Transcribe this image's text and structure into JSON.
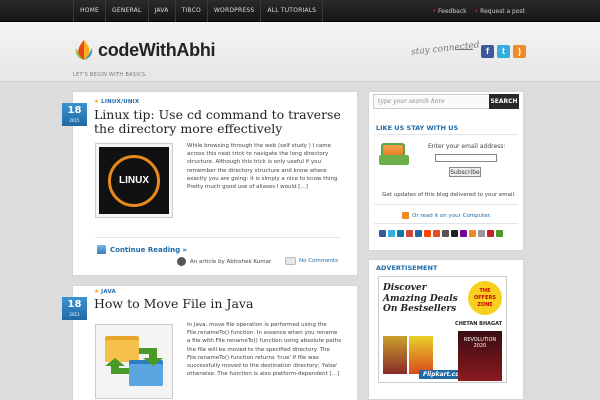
{
  "nav": {
    "items": [
      "HOME",
      "GENERAL",
      "JAVA",
      "TIBCO",
      "WORDPRESS",
      "ALL TUTORIALS"
    ],
    "feedback": "Feedback",
    "request": "Request a post"
  },
  "header": {
    "logo_text": "codeWithAbhi",
    "tagline": "LET'S BEGIN WITH BASICS.",
    "stay_connected": "stay connected"
  },
  "posts": [
    {
      "day": "18",
      "year": "2015",
      "category": "LINUX/UNIX",
      "title": "Linux tip: Use cd command to traverse the directory more effectively",
      "thumb_label": "LINUX",
      "excerpt": "While browsing through the web (self study ) I came across this neat trick to navigate the long directory structure. Although this trick is only useful if you remember the directory structure and know where exactly you are going: it is simply a nice to know thing. Pretty much good use of aliases I would [...]",
      "read_more": "Continue Reading »",
      "author": "An article by Abhishek Kumar",
      "comments": "No Comments"
    },
    {
      "day": "18",
      "year": "2013",
      "category": "JAVA",
      "title": "How to Move File in Java",
      "excerpt": "In Java, move file operation is performed using the File.renameTo() function. In essence when you rename a file with File.renameTo() function using absolute paths the file will be moved to the specified directory. The File.renameTo() function returns 'true' if file was successfully moved to the destination directory; 'false' otherwise. The function is also platform-dependent [...]"
    }
  ],
  "sidebar": {
    "search_placeholder": "type your search here",
    "search_button": "SEARCH",
    "stay_heading": "LIKE US STAY WITH US",
    "email_label": "Enter your email address:",
    "subscribe": "Subscribe",
    "updates_text": "Get updates of this blog delivered to your email.",
    "read_it": "Or read it on your Computer.",
    "ad_heading": "ADVERTISEMENT",
    "ad": {
      "line1": "Discover",
      "line2": "Amazing Deals",
      "line3": "On Bestsellers",
      "tag": "THE OFFERS ZONE",
      "author": "CHETAN BHAGAT",
      "book": "REVOLUTION 2020",
      "store": "Flipkart.com"
    }
  }
}
